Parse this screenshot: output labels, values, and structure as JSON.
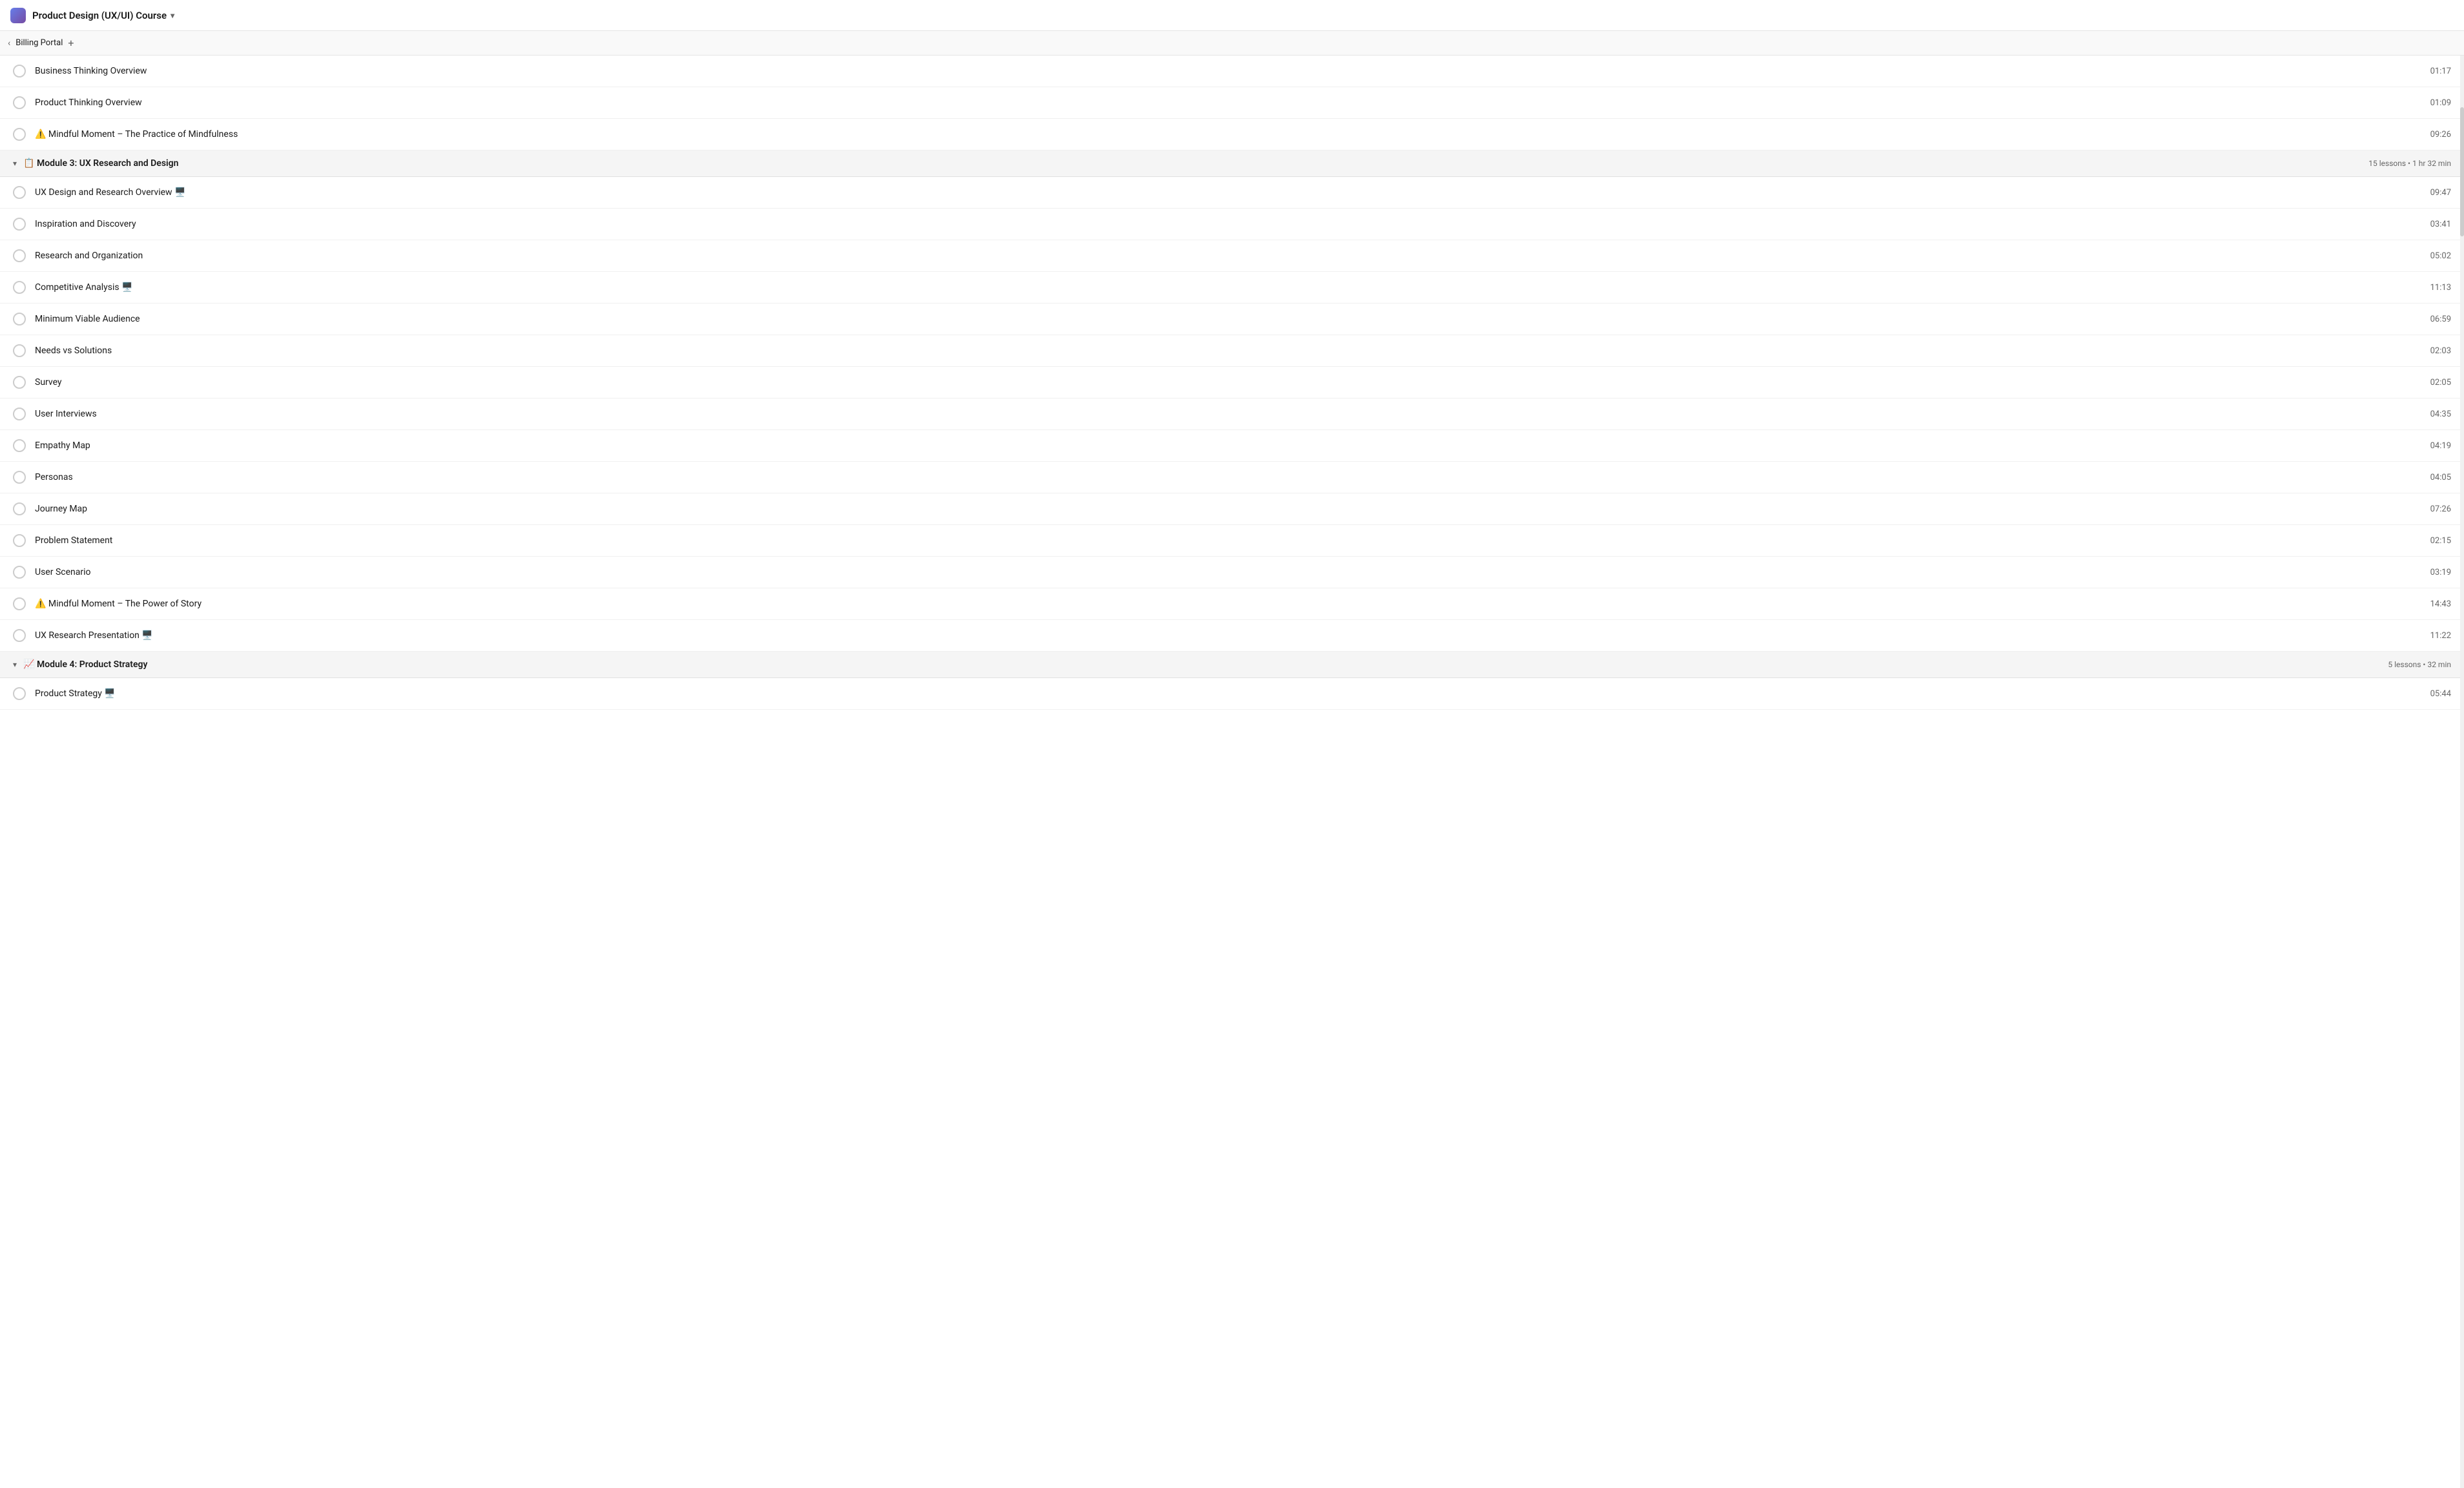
{
  "topbar": {
    "course_title": "Product Design (UX/UI) Course",
    "chevron": "▾"
  },
  "breadcrumb": {
    "back_label": "‹",
    "tab_label": "Billing Portal",
    "add_label": "+"
  },
  "lessons_before_module3": [
    {
      "title": "Business Thinking Overview",
      "duration": "01:17"
    },
    {
      "title": "Product Thinking Overview",
      "duration": "01:09"
    },
    {
      "title": "⚠️ Mindful Moment – The Practice of Mindfulness",
      "duration": "09:26"
    }
  ],
  "module3": {
    "emoji": "📋",
    "title": "Module 3: UX Research and Design",
    "meta": "15 lessons • 1 hr 32 min",
    "lessons": [
      {
        "title": "UX Design and Research Overview 🖥️",
        "duration": "09:47"
      },
      {
        "title": "Inspiration and Discovery",
        "duration": "03:41"
      },
      {
        "title": "Research and Organization",
        "duration": "05:02"
      },
      {
        "title": "Competitive Analysis 🖥️",
        "duration": "11:13"
      },
      {
        "title": "Minimum Viable Audience",
        "duration": "06:59"
      },
      {
        "title": "Needs vs Solutions",
        "duration": "02:03"
      },
      {
        "title": "Survey",
        "duration": "02:05"
      },
      {
        "title": "User Interviews",
        "duration": "04:35"
      },
      {
        "title": "Empathy Map",
        "duration": "04:19"
      },
      {
        "title": "Personas",
        "duration": "04:05"
      },
      {
        "title": "Journey Map",
        "duration": "07:26"
      },
      {
        "title": "Problem Statement",
        "duration": "02:15"
      },
      {
        "title": "User Scenario",
        "duration": "03:19"
      },
      {
        "title": "⚠️ Mindful Moment – The Power of Story",
        "duration": "14:43"
      },
      {
        "title": "UX Research Presentation 🖥️",
        "duration": "11:22"
      }
    ]
  },
  "module4": {
    "emoji": "📈",
    "title": "Module 4: Product Strategy",
    "meta": "5 lessons • 32 min",
    "lessons": [
      {
        "title": "Product Strategy 🖥️",
        "duration": "05:44"
      }
    ]
  }
}
